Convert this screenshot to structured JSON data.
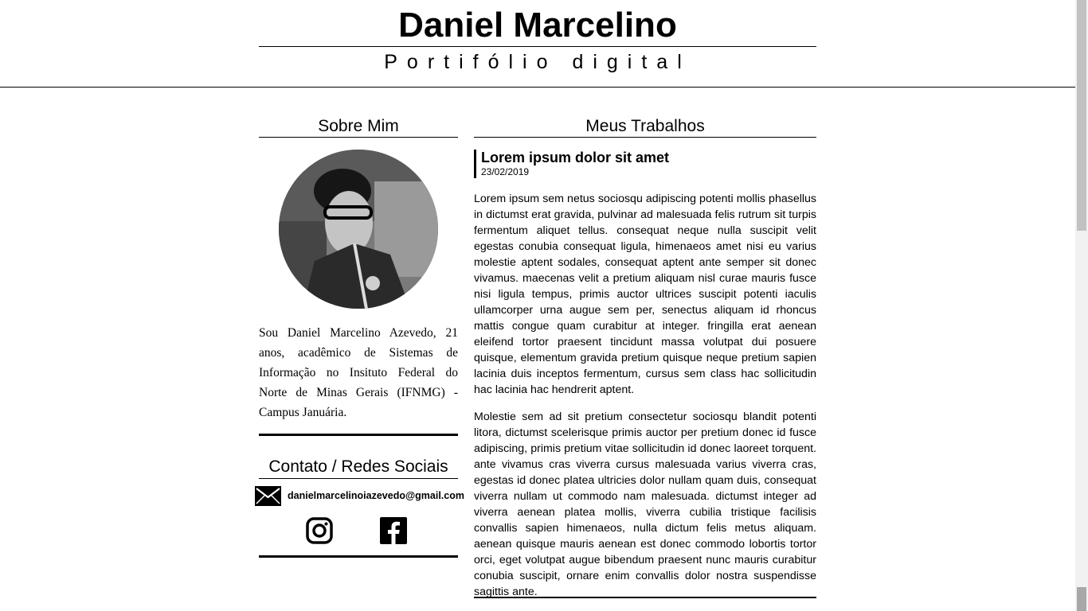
{
  "header": {
    "name": "Daniel Marcelino",
    "subtitle": "Portifólio digital"
  },
  "about": {
    "title": "Sobre Mim",
    "avatar_alt": "avatar",
    "bio": "Sou Daniel Marcelino Azevedo, 21 anos, acadêmico de Sistemas de Informação no Insituto Federal do Norte de Minas Gerais (IFNMG) - Campus Januária."
  },
  "contact": {
    "title": "Contato / Redes Sociais",
    "email": "danielmarcelinoiazevedo@gmail.com",
    "icons": [
      "mail-icon",
      "instagram-icon",
      "facebook-icon"
    ]
  },
  "works": {
    "title": "Meus Trabalhos",
    "post": {
      "title": "Lorem ipsum dolor sit amet",
      "date": "23/02/2019",
      "paragraphs": [
        "Lorem ipsum sem netus sociosqu adipiscing potenti mollis phasellus in dictumst erat gravida, pulvinar ad malesuada felis rutrum sit turpis fermentum aliquet tellus. consequat neque nulla suscipit velit egestas conubia consequat ligula, himenaeos amet nisi eu varius molestie aptent sodales, consequat aptent ante semper sit donec vivamus. maecenas velit a pretium aliquam nisl curae mauris fusce nisi ligula tempus, primis auctor ultrices suscipit potenti iaculis ullamcorper urna augue sem per, senectus aliquam id rhoncus mattis congue quam curabitur at integer. fringilla erat aenean eleifend tortor praesent tincidunt massa volutpat dui posuere quisque, elementum gravida pretium quisque neque pretium sapien lacinia duis inceptos fermentum, cursus sem class hac sollicitudin hac lacinia hac hendrerit aptent.",
        "Molestie sem ad sit pretium consectetur sociosqu blandit potenti litora, dictumst scelerisque primis auctor per pretium donec id fusce adipiscing, primis pretium vitae sollicitudin id donec laoreet torquent. ante vivamus cras viverra cursus malesuada varius viverra cras, egestas id donec platea ultricies dolor nullam quam duis, consequat viverra nullam ut commodo nam malesuada. dictumst integer ad viverra aenean platea mollis, viverra cubilia tristique facilisis convallis sapien himenaeos, nulla dictum felis metus aliquam. aenean quisque mauris aenean est donec commodo lobortis tortor orci, eget volutpat augue bibendum praesent nunc mauris curabitur conubia suscipit, ornare enim convallis dolor nostra suspendisse sagittis ante."
      ]
    }
  },
  "colors": {
    "text": "#000000",
    "background": "#ffffff",
    "scrollbar": "#f1f1f1"
  }
}
